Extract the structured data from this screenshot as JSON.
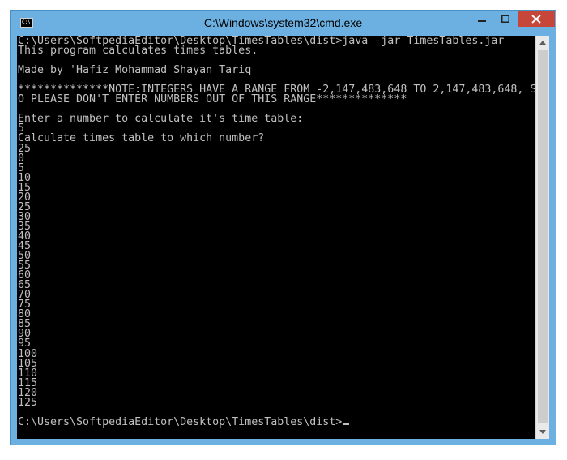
{
  "window": {
    "title": "C:\\Windows\\system32\\cmd.exe"
  },
  "console": {
    "lines": [
      "C:\\Users\\SoftpediaEditor\\Desktop\\TimesTables\\dist>java -jar TimesTables.jar",
      "This program calculates times tables.",
      "",
      "Made by 'Hafiz Mohammad Shayan Tariq",
      "",
      "**************NOTE:INTEGERS HAVE A RANGE FROM -2,147,483,648 TO 2,147,483,648, S",
      "O PLEASE DON'T ENTER NUMBERS OUT OF THIS RANGE**************",
      "",
      "Enter a number to calculate it's time table:",
      "5",
      "Calculate times table to which number?",
      "25",
      "0",
      "5",
      "10",
      "15",
      "20",
      "25",
      "30",
      "35",
      "40",
      "45",
      "50",
      "55",
      "60",
      "65",
      "70",
      "75",
      "80",
      "85",
      "90",
      "95",
      "100",
      "105",
      "110",
      "115",
      "120",
      "125",
      ""
    ],
    "prompt": "C:\\Users\\SoftpediaEditor\\Desktop\\TimesTables\\dist>"
  },
  "icons": {
    "app": "cmd-icon",
    "minimize": "minimize-icon",
    "maximize": "maximize-icon",
    "close": "close-icon",
    "scroll_up": "scroll-up-arrow-icon",
    "scroll_down": "scroll-down-arrow-icon"
  },
  "colors": {
    "frame": "#6bb0e0",
    "console_bg": "#000000",
    "console_text": "#c0c0c0",
    "close_button": "#c7463a"
  }
}
